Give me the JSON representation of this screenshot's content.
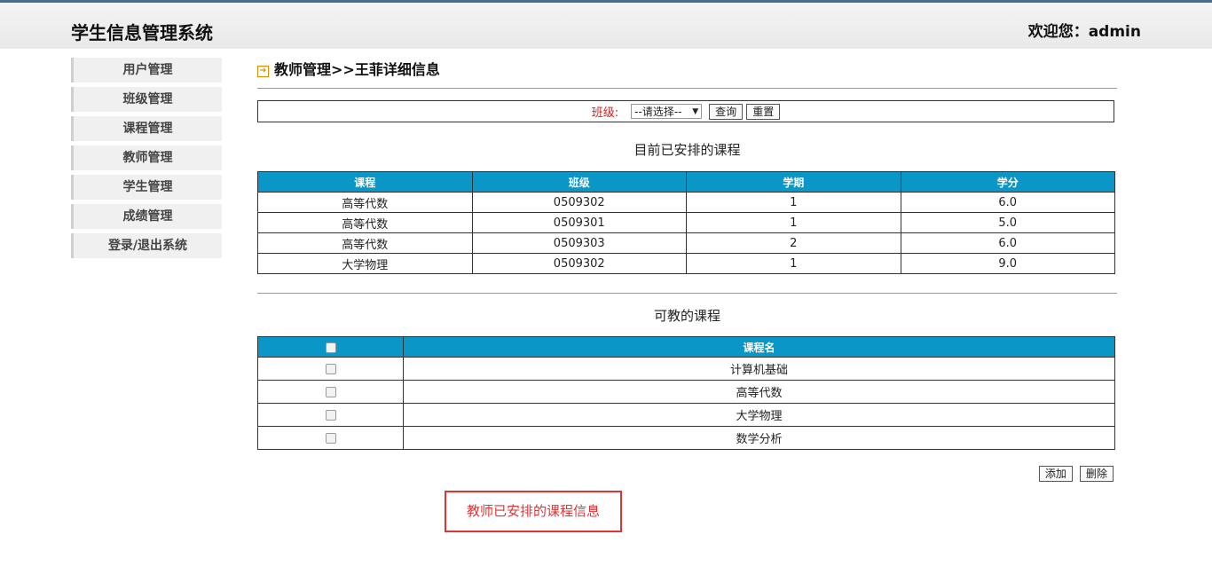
{
  "header": {
    "app_title": "学生信息管理系统",
    "welcome": "欢迎您：admin"
  },
  "sidebar": {
    "items": [
      {
        "label": "用户管理"
      },
      {
        "label": "班级管理"
      },
      {
        "label": "课程管理"
      },
      {
        "label": "教师管理"
      },
      {
        "label": "学生管理"
      },
      {
        "label": "成绩管理"
      },
      {
        "label": "登录/退出系统"
      }
    ]
  },
  "breadcrumb": "教师管理>>王菲详细信息",
  "filter": {
    "label": "班级:",
    "select_value": "--请选择--",
    "query": "查询",
    "reset": "重置"
  },
  "scheduled": {
    "title": "目前已安排的课程",
    "headers": [
      "课程",
      "班级",
      "学期",
      "学分"
    ],
    "rows": [
      [
        "高等代数",
        "0509302",
        "1",
        "6.0"
      ],
      [
        "高等代数",
        "0509301",
        "1",
        "5.0"
      ],
      [
        "高等代数",
        "0509303",
        "2",
        "6.0"
      ],
      [
        "大学物理",
        "0509302",
        "1",
        "9.0"
      ]
    ]
  },
  "teachable": {
    "title": "可教的课程",
    "header": "课程名",
    "rows": [
      "计算机基础",
      "高等代数",
      "大学物理",
      "数学分析"
    ]
  },
  "actions": {
    "add": "添加",
    "delete": "删除"
  },
  "annotation": "教师已安排的课程信息",
  "colors": {
    "table_header": "#0a96c6",
    "annotation": "#e03434",
    "filter_label": "#d02020"
  }
}
